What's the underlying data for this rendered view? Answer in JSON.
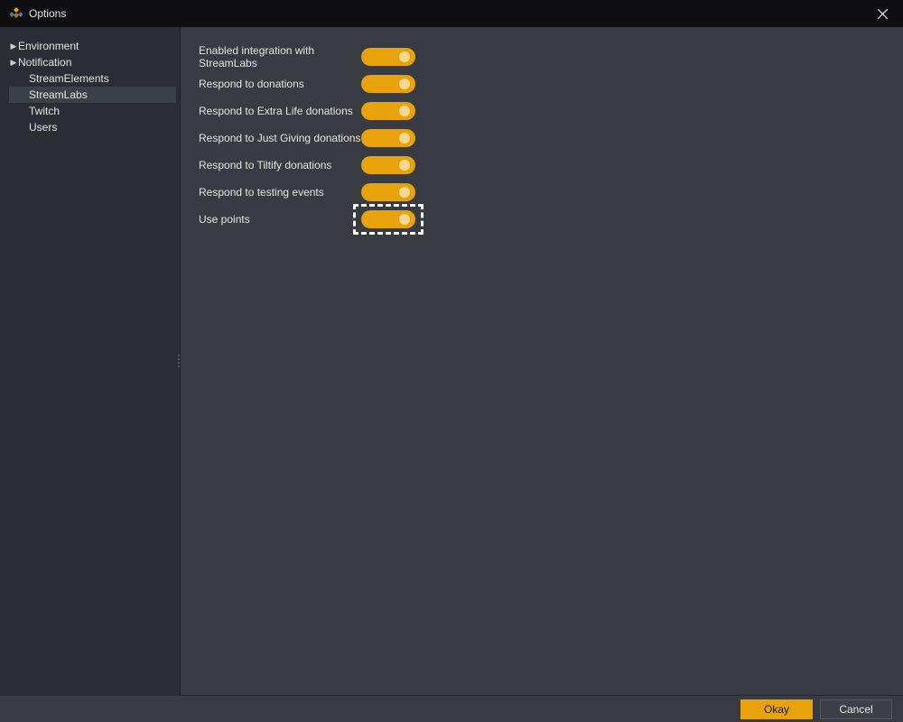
{
  "window": {
    "title": "Options"
  },
  "sidebar": {
    "items": [
      {
        "label": "Environment",
        "expandable": true
      },
      {
        "label": "Notification",
        "expandable": true
      },
      {
        "label": "StreamElements",
        "expandable": false
      },
      {
        "label": "StreamLabs",
        "expandable": false,
        "selected": true
      },
      {
        "label": "Twitch",
        "expandable": false
      },
      {
        "label": "Users",
        "expandable": false
      }
    ]
  },
  "settings": {
    "rows": [
      {
        "label": "Enabled integration with StreamLabs",
        "on": true
      },
      {
        "label": "Respond to donations",
        "on": true
      },
      {
        "label": "Respond to Extra Life donations",
        "on": true
      },
      {
        "label": "Respond to Just Giving donations",
        "on": true
      },
      {
        "label": "Respond to Tiltify donations",
        "on": true
      },
      {
        "label": "Respond to testing events",
        "on": true
      },
      {
        "label": "Use points",
        "on": true,
        "highlighted": true
      }
    ]
  },
  "footer": {
    "okay": "Okay",
    "cancel": "Cancel"
  },
  "colors": {
    "accent": "#e8a20c",
    "bg_main": "#383c42",
    "bg_sidebar": "#2a2e34",
    "bg_titlebar": "#0f0f11"
  }
}
